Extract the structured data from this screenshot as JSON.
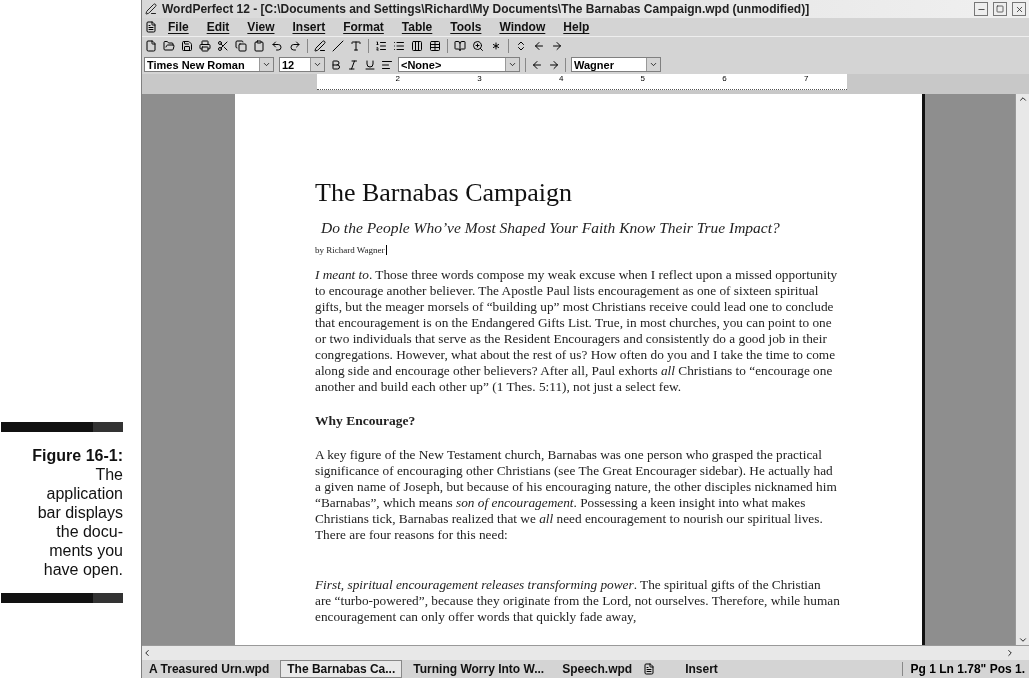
{
  "caption": {
    "label": "Figure 16-1:",
    "lines": [
      "The",
      "application",
      "bar displays",
      "the docu-",
      "ments you",
      "have open."
    ]
  },
  "window": {
    "title": "WordPerfect 12 - [C:\\Documents and Settings\\Richard\\My Documents\\The Barnabas Campaign.wpd (unmodified)]"
  },
  "menu": [
    "File",
    "Edit",
    "View",
    "Insert",
    "Format",
    "Table",
    "Tools",
    "Window",
    "Help"
  ],
  "property_bar": {
    "font": "Times New Roman",
    "size": "12",
    "style": "<None>",
    "user": "Wagner"
  },
  "ruler": [
    "2",
    "3",
    "4",
    "5",
    "6",
    "7"
  ],
  "document": {
    "title": "The Barnabas Campaign",
    "subtitle": "Do the People Who’ve Most Shaped Your Faith Know Their True Impact?",
    "byline": "by Richard Wagner",
    "blocks": [
      {
        "kind": "body",
        "text": "*I meant to*. Those three words compose my weak excuse when I reflect upon a missed opportunity to encourage another believer. The Apostle Paul lists encouragement as one of sixteen spiritual gifts, but the meager morsels of “building up” most Christians receive could lead one to conclude that encouragement is on the Endangered Gifts List. True, in most churches, you can point to one or two individuals that serve as the Resident Encouragers and consistently do a good job in their congregations. However, what about the rest of us? How often do you and I take the time to come along side and encourage other believers? After all, Paul exhorts *all* Christians to “encourage one another and build each other up” (1 Thes. 5:11), not just a select few."
      },
      {
        "kind": "heading",
        "text": "Why Encourage?"
      },
      {
        "kind": "body",
        "text": "A key figure of the New Testament church, Barnabas was one person who grasped the practical significance of encouraging other Christians (see The Great Encourager sidebar). He actually had a given name of Joseph, but because of his encouraging nature, the other disciples nicknamed him “Barnabas”, which means *son of encouragement*. Possessing a keen insight into what makes Christians tick, Barnabas realized that we *all* need encouragement to nourish our spiritual lives. There are four reasons for this need:"
      },
      {
        "kind": "body",
        "text": "*First, spiritual encouragement releases transforming power*. The spiritual gifts of the Christian are “turbo-powered”, because they originate from the Lord, not ourselves. Therefore, while human encouragement can only offer words that quickly fade away,"
      }
    ]
  },
  "app_bar": {
    "documents": [
      {
        "label": "A Treasured Urn.wpd",
        "selected": false
      },
      {
        "label": "The Barnabas Ca...",
        "selected": true
      },
      {
        "label": "Turning Worry Into W...",
        "selected": false
      },
      {
        "label": "Speech.wpd",
        "selected": false
      }
    ],
    "mode": "Insert",
    "position": "Pg 1 Ln 1.78\" Pos 1."
  }
}
